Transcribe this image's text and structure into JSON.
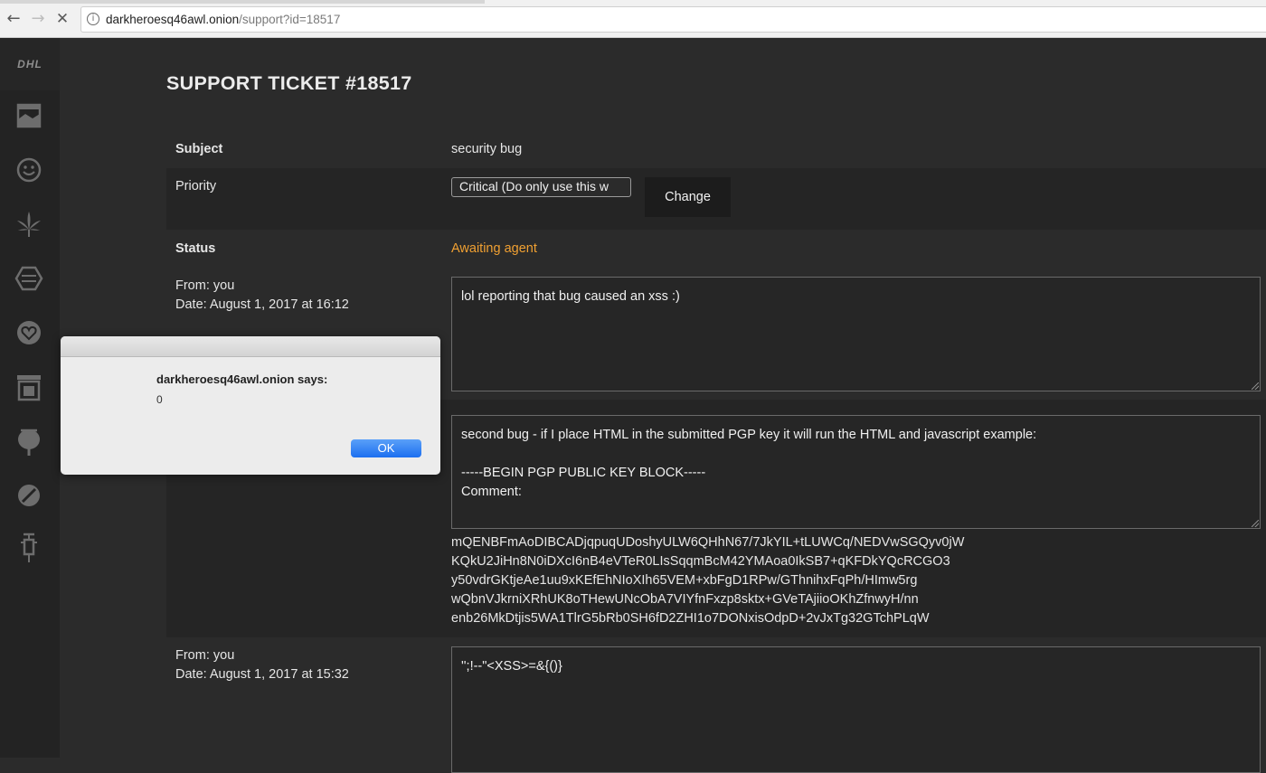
{
  "browser": {
    "url_host": "darkheroesq46awl.onion",
    "url_path": "/support?id=18517",
    "back_icon": "←",
    "forward_icon": "→",
    "stop_icon": "✕",
    "info_icon": "i"
  },
  "sidebar": {
    "logo": "DHL",
    "icons": [
      "store-icon",
      "smiley-icon",
      "cannabis-leaf-icon",
      "hexagon-icon",
      "heart-circle-icon",
      "shop-icon",
      "poppy-icon",
      "pill-icon",
      "syringe-icon"
    ]
  },
  "ticket": {
    "title": "SUPPORT TICKET #18517",
    "subject_label": "Subject",
    "subject_value": "security bug",
    "priority_label": "Priority",
    "priority_value": "Critical (Do only use this w",
    "change_button": "Change",
    "status_label": "Status",
    "status_value": "Awaiting agent",
    "status_color": "#f0a032"
  },
  "messages": [
    {
      "from": "From: you",
      "date": "Date: August 1, 2017 at 16:12",
      "body": "lol reporting that bug caused an xss :)"
    },
    {
      "body": "second bug - if I place HTML in the submitted PGP key it will run the HTML and javascript example:\n\n-----BEGIN PGP PUBLIC KEY BLOCK-----\nComment:",
      "extra_lines": [
        "mQENBFmAoDIBCADjqpuqUDoshyULW6QHhN67/7JkYIL+tLUWCq/NEDVwSGQyv0jW",
        "KQkU2JiHn8N0iDXcI6nB4eVTeR0LIsSqqmBcM42YMAoa0IkSB7+qKFDkYQcRCGO3",
        "y50vdrGKtjeAe1uu9xKEfEhNIoXIh65VEM+xbFgD1RPw/GThnihxFqPh/HImw5rg",
        "wQbnVJkrniXRhUK8oTHewUNcObA7VIYfnFxzp8sktx+GVeTAjiioOKhZfnwyH/nn",
        "enb26MkDtjis5WA1TlrG5bRb0SH6fD2ZHI1o7DONxisOdpD+2vJxTg32GTchPLqW"
      ]
    },
    {
      "from": "From: you",
      "date": "Date: August 1, 2017 at 15:32",
      "body": "'';!--\"<XSS>=&{()}"
    }
  ],
  "dialog": {
    "title": "darkheroesq46awl.onion says:",
    "message": "0",
    "ok_label": "OK"
  }
}
